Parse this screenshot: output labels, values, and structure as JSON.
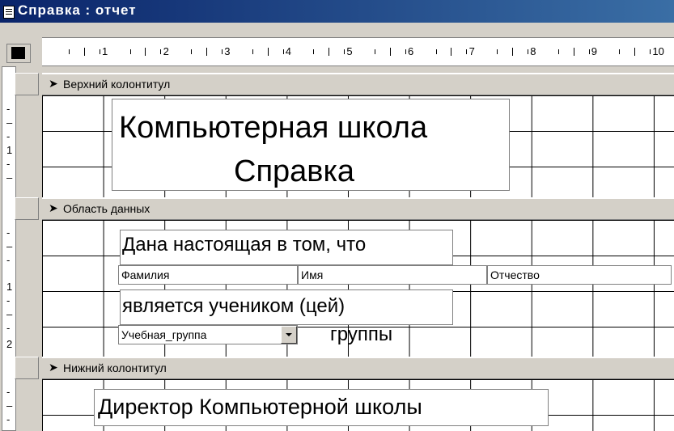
{
  "window": {
    "title": "Справка : отчет"
  },
  "ruler": {
    "numbers": [
      "1",
      "2",
      "3",
      "4",
      "5",
      "6",
      "7",
      "8",
      "9",
      "10"
    ]
  },
  "vruler_marks": {
    "header": [
      "1"
    ],
    "data": [
      "1",
      "2"
    ]
  },
  "sections": {
    "header": {
      "label": "Верхний колонтитул",
      "title_line1": "Компьютерная школа",
      "title_line2": "Справка"
    },
    "data": {
      "label": "Область данных",
      "text1": "Дана настоящая в том, что",
      "field_surname": "Фамилия",
      "field_name": "Имя",
      "field_patronymic": "Отчество",
      "text2": "является учеником (цей)",
      "combo_group": "Учебная_группа",
      "text3": "группы"
    },
    "footer": {
      "label": "Нижний колонтитул",
      "director_text": "Директор Компьютерной школы"
    }
  }
}
